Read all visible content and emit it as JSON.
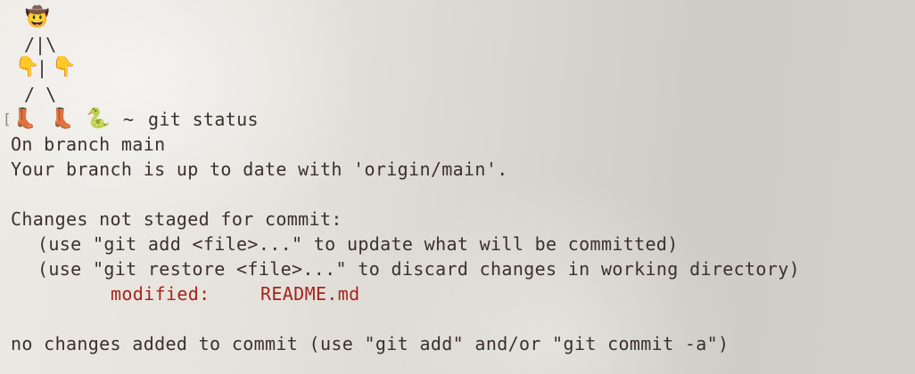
{
  "art": {
    "head": "🤠",
    "arms_top": "/|\\",
    "hand_left": "👇",
    "torso": "|",
    "hand_right": "👇",
    "legs": "/ \\",
    "boot_left": "👢",
    "boot_right": "👢",
    "snake": "🐍"
  },
  "prompt": {
    "bracket": "[",
    "symbol": "~",
    "command": "git status"
  },
  "output": {
    "line1": "On branch main",
    "line2": "Your branch is up to date with 'origin/main'.",
    "line3": "Changes not staged for commit:",
    "line4": "(use \"git add <file>...\" to update what will be committed)",
    "line5": "(use \"git restore <file>...\" to discard changes in working directory)",
    "modified_label": "modified:",
    "modified_file": "README.md",
    "line7": "no changes added to commit (use \"git add\" and/or \"git commit -a\")"
  },
  "colors": {
    "text": "#3a302c",
    "modified": "#a5241c"
  }
}
